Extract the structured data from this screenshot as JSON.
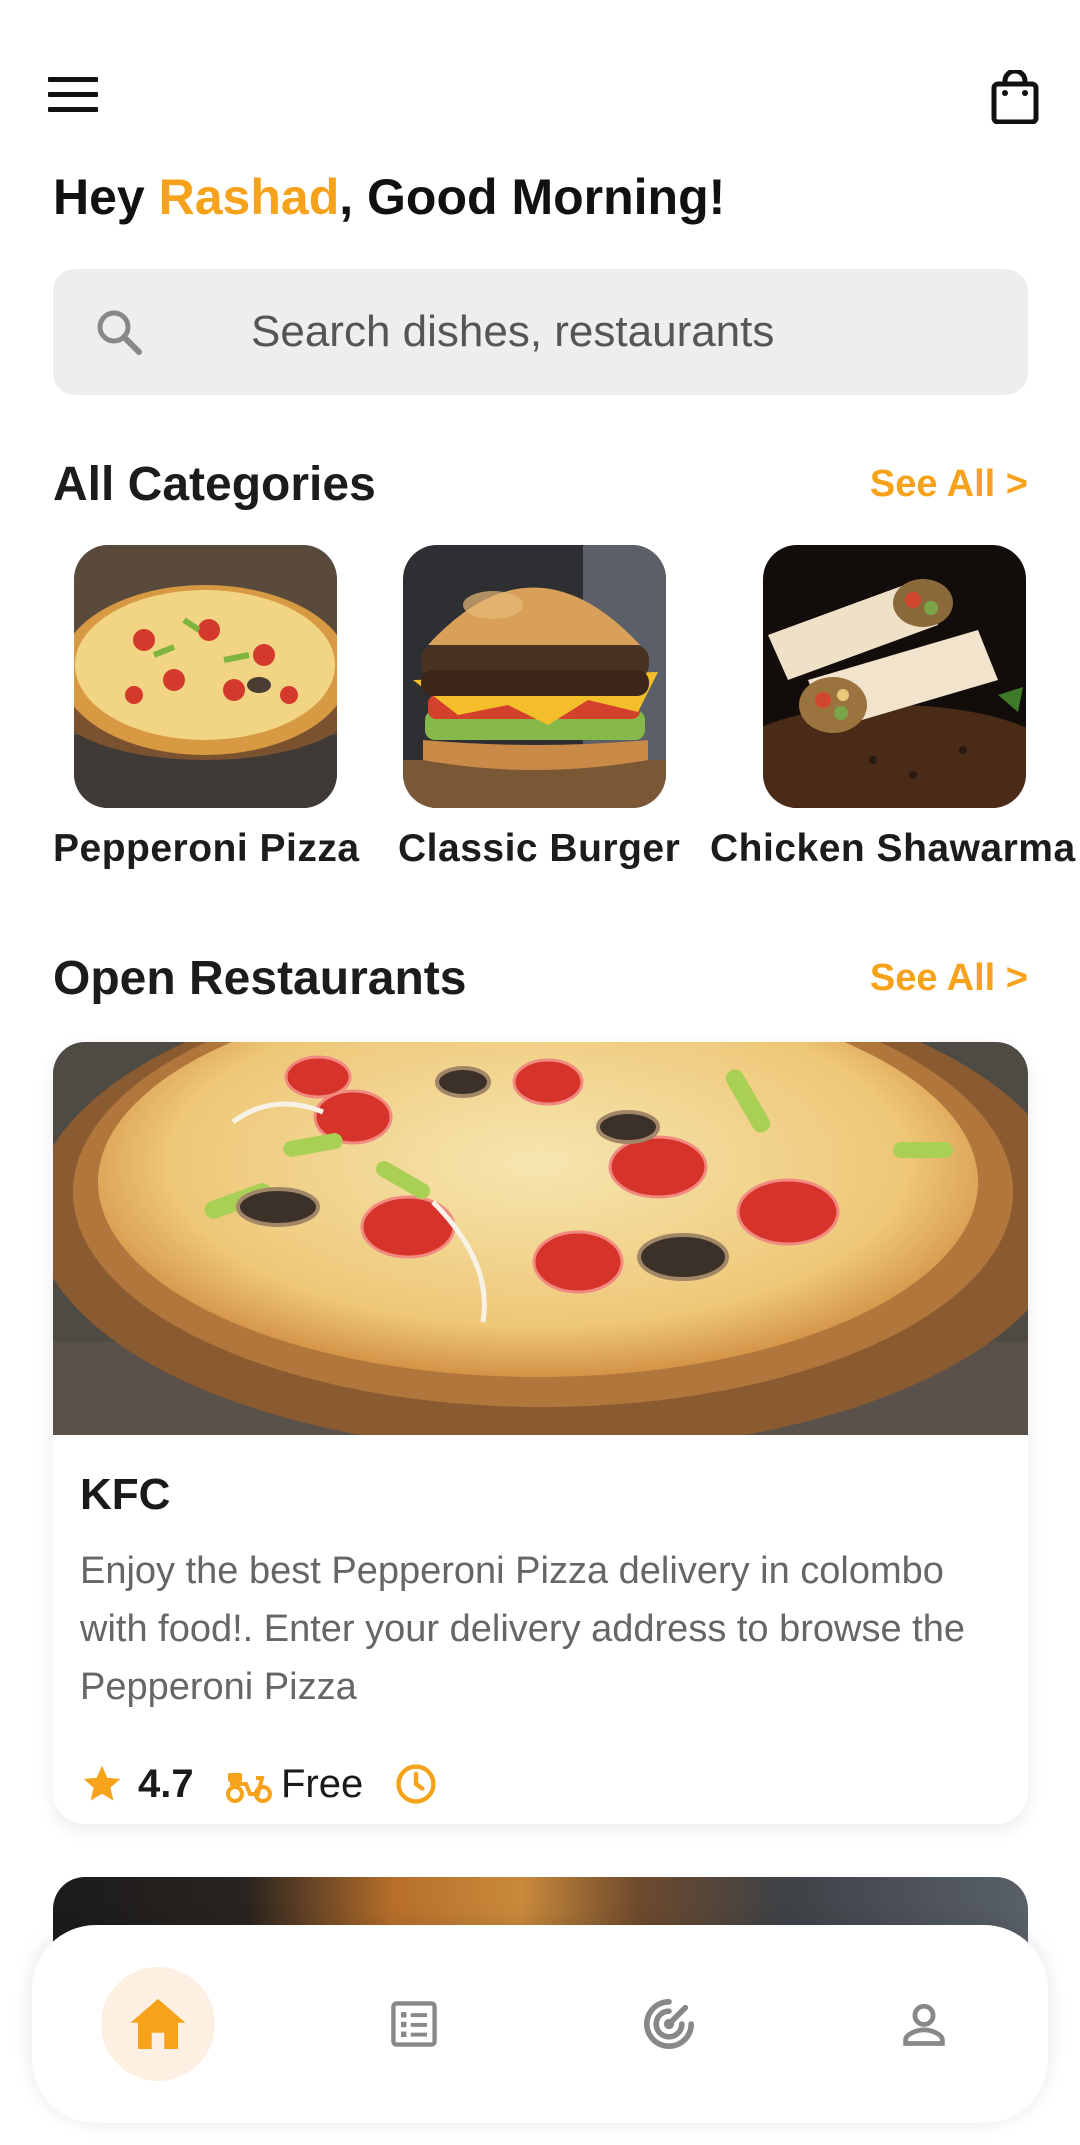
{
  "header": {
    "menu_icon": "hamburger-menu-icon",
    "cart_icon": "shopping-bag-icon",
    "greeting_prefix": "Hey ",
    "user_name": "Rashad",
    "greeting_suffix": ", Good Morning!"
  },
  "search": {
    "placeholder": "Search dishes, restaurants",
    "icon": "search-icon"
  },
  "categories": {
    "title": "All Categories",
    "see_all": "See All >",
    "items": [
      {
        "label": "Pepperoni Pizza"
      },
      {
        "label": "Classic Burger"
      },
      {
        "label": "Chicken Shawarma"
      }
    ]
  },
  "restaurants": {
    "title": "Open Restaurants",
    "see_all": "See All >",
    "items": [
      {
        "name": "KFC",
        "description": "Enjoy the best Pepperoni Pizza delivery in colombo with food!. Enter your delivery address to browse the Pepperoni Pizza",
        "rating": "4.7",
        "delivery": "Free"
      }
    ]
  },
  "bottom_nav": {
    "items": [
      {
        "icon": "home-icon",
        "active": true
      },
      {
        "icon": "orders-list-icon",
        "active": false
      },
      {
        "icon": "radar-icon",
        "active": false
      },
      {
        "icon": "profile-icon",
        "active": false
      }
    ]
  },
  "colors": {
    "accent": "#f7a21b",
    "search_bg": "#eeeeee",
    "nav_active_bg": "#fdf0e2"
  }
}
